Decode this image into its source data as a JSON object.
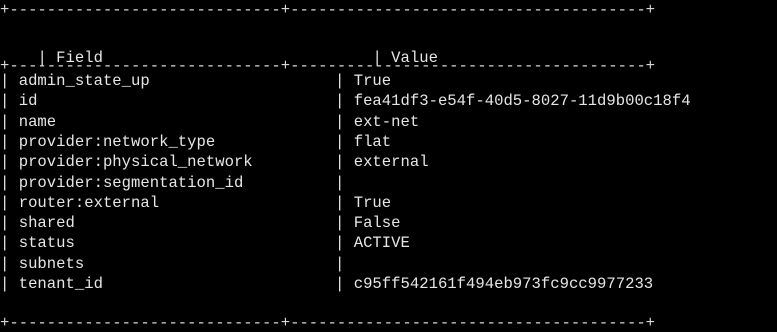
{
  "table": {
    "top_border": "+-----------------------------+--------------------------------------+",
    "header_border": "+-----------------------------+--------------------------------------+",
    "bottom_border": "+-----------------------------+--------------------------------------+",
    "header": {
      "field": "Field",
      "value": "Value"
    },
    "rows": [
      {
        "field": "admin_state_up",
        "value": "True"
      },
      {
        "field": "id",
        "value": "fea41df3-e54f-40d5-8027-11d9b00c18f4"
      },
      {
        "field": "name",
        "value": "ext-net"
      },
      {
        "field": "provider:network_type",
        "value": "flat"
      },
      {
        "field": "provider:physical_network",
        "value": "external"
      },
      {
        "field": "provider:segmentation_id",
        "value": ""
      },
      {
        "field": "router:external",
        "value": "True"
      },
      {
        "field": "shared",
        "value": "False"
      },
      {
        "field": "status",
        "value": "ACTIVE"
      },
      {
        "field": "subnets",
        "value": ""
      },
      {
        "field": "tenant_id",
        "value": "c95ff542161f494eb973fc9cc9977233"
      }
    ]
  },
  "colors": {
    "background": "#000000",
    "text": "#e6e6e6"
  }
}
